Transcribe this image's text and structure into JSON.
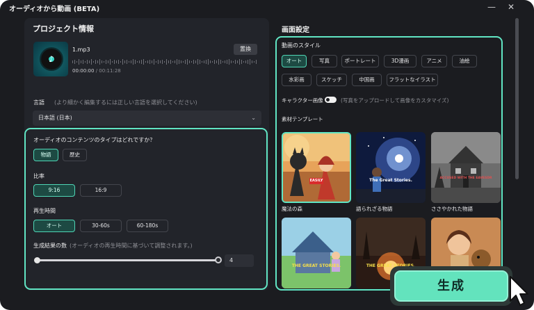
{
  "window": {
    "title": "オーディオから動画 (BETA)",
    "minimize_icon": "minimize-icon",
    "close_icon": "close-icon"
  },
  "project": {
    "heading": "プロジェクト情報",
    "file": {
      "name": "1.mp3",
      "replace_label": "置換",
      "current_time": "00:00:00",
      "separator": "/",
      "total_time": "00:11:28"
    },
    "language": {
      "label": "言語",
      "hint": "(より細かく編集するには正しい言語を選択してください)",
      "value": "日本語 (日本)"
    },
    "content_type": {
      "question": "オーディオのコンテンツのタイプはどれですか？",
      "options": [
        "物語",
        "歴史"
      ],
      "selected": "物語"
    },
    "ratio": {
      "label": "比率",
      "options": [
        "9:16",
        "16:9"
      ],
      "selected": "9:16"
    },
    "duration": {
      "label": "再生時間",
      "options": [
        "オート",
        "30-60s",
        "60-180s"
      ],
      "selected": "オート"
    },
    "results": {
      "label": "生成結果の数",
      "hint": "(オーディオの再生時間に基づいて調整されます。)",
      "value": "4"
    }
  },
  "screen": {
    "heading": "画面設定",
    "style_label": "動画のスタイル",
    "styles": [
      "オート",
      "写真",
      "ポートレート",
      "3D漫画",
      "アニメ",
      "油絵",
      "水彩画",
      "スケッチ",
      "中国画",
      "フラットなイラスト"
    ],
    "selected_style": "オート",
    "character": {
      "label": "キャラクター画像",
      "hint": "(写真をアップロードして画像をカスタマイズ)",
      "enabled": false
    },
    "template_label": "素材テンプレート",
    "templates": [
      {
        "name": "魔法の森",
        "badge": "EASILY"
      },
      {
        "name": "語られざる物語",
        "badge": "The Great Stories."
      },
      {
        "name": "ささやかれた物語",
        "badge": "ACCUSED WITH THE EAVESDR"
      },
      {
        "name": "",
        "badge": "THE GREAT STORIES."
      },
      {
        "name": "",
        "badge": "THE GREAT STORIES."
      },
      {
        "name": "",
        "badge": ""
      }
    ]
  },
  "generate_label": "生成",
  "colors": {
    "accent": "#61e6c4",
    "background": "#1b1c20",
    "panel": "#22242a",
    "button": "#63e3bd"
  }
}
